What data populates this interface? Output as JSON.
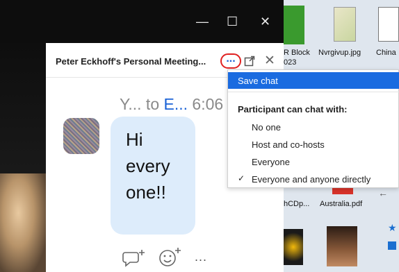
{
  "window": {
    "minimize_icon": "minimize-icon",
    "maximize_icon": "maximize-icon",
    "close_icon": "close-icon"
  },
  "desktop": {
    "icons": [
      {
        "label": "R Block",
        "sub": "023"
      },
      {
        "label": "Nvrgivup.jpg"
      },
      {
        "label": "China"
      },
      {
        "label": "hCDp..."
      },
      {
        "label": "Australia.pdf"
      }
    ]
  },
  "chat": {
    "title": "Peter Eckhoff's Personal Meeting...",
    "more_label": "...",
    "message": {
      "sender": "Y...",
      "to_word": " to ",
      "recipient": "E...",
      "time": " 6:06",
      "text": "Hi\nevery\none!!"
    },
    "footer_more": "..."
  },
  "menu": {
    "save_chat": "Save chat",
    "heading": "Participant can chat with:",
    "options": [
      "No one",
      "Host and co-hosts",
      "Everyone",
      "Everyone and anyone directly"
    ],
    "selected_check": "✓",
    "accent": "#1a6be0"
  }
}
